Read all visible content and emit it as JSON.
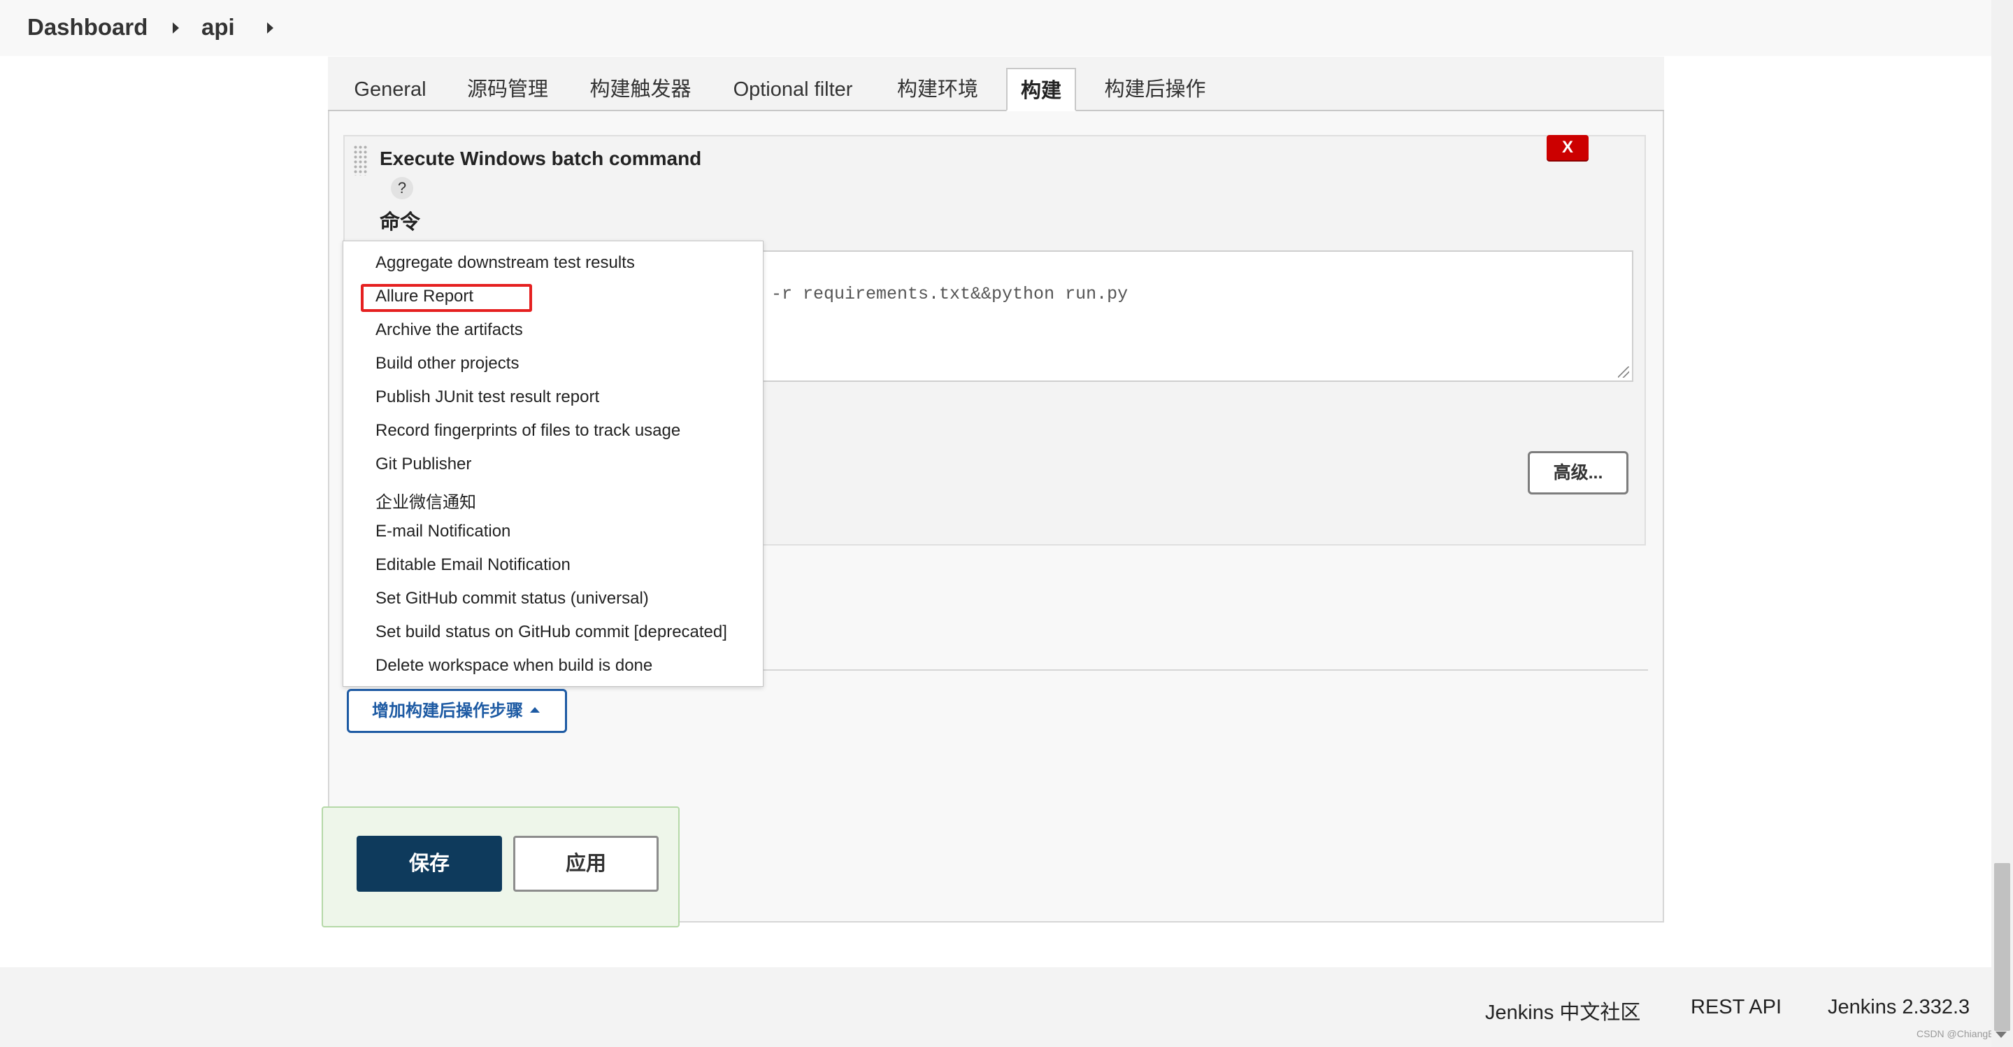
{
  "breadcrumb": {
    "items": [
      "Dashboard",
      "api"
    ]
  },
  "tabs": [
    "General",
    "源码管理",
    "构建触发器",
    "Optional filter",
    "构建环境",
    "构建",
    "构建后操作"
  ],
  "active_tab": "构建",
  "build_step": {
    "title": "Execute Windows batch command",
    "help": "?",
    "command_label": "命令",
    "delete_label": "X",
    "command_value": "-r requirements.txt&&python run.py",
    "advanced_label": "高级..."
  },
  "dropdown": {
    "items": [
      "Aggregate downstream test results",
      "Allure Report",
      "Archive the artifacts",
      "Build other projects",
      "Publish JUnit test result report",
      "Record fingerprints of files to track usage",
      "Git Publisher",
      "企业微信通知",
      "E-mail Notification",
      "Editable Email Notification",
      "Set GitHub commit status (universal)",
      "Set build status on GitHub commit [deprecated]",
      "Delete workspace when build is done"
    ],
    "highlighted": "Allure Report"
  },
  "add_post_build_label": "增加构建后操作步骤",
  "buttons": {
    "save": "保存",
    "apply": "应用"
  },
  "footer": {
    "community": "Jenkins 中文社区",
    "rest_api": "REST API",
    "version": "Jenkins 2.332.3"
  },
  "watermark": "CSDN @ChiangBa",
  "colors": {
    "accent": "#1d5aa3",
    "save_button": "#0e3a5c",
    "delete_button": "#cc0000",
    "highlight": "#e52020"
  }
}
